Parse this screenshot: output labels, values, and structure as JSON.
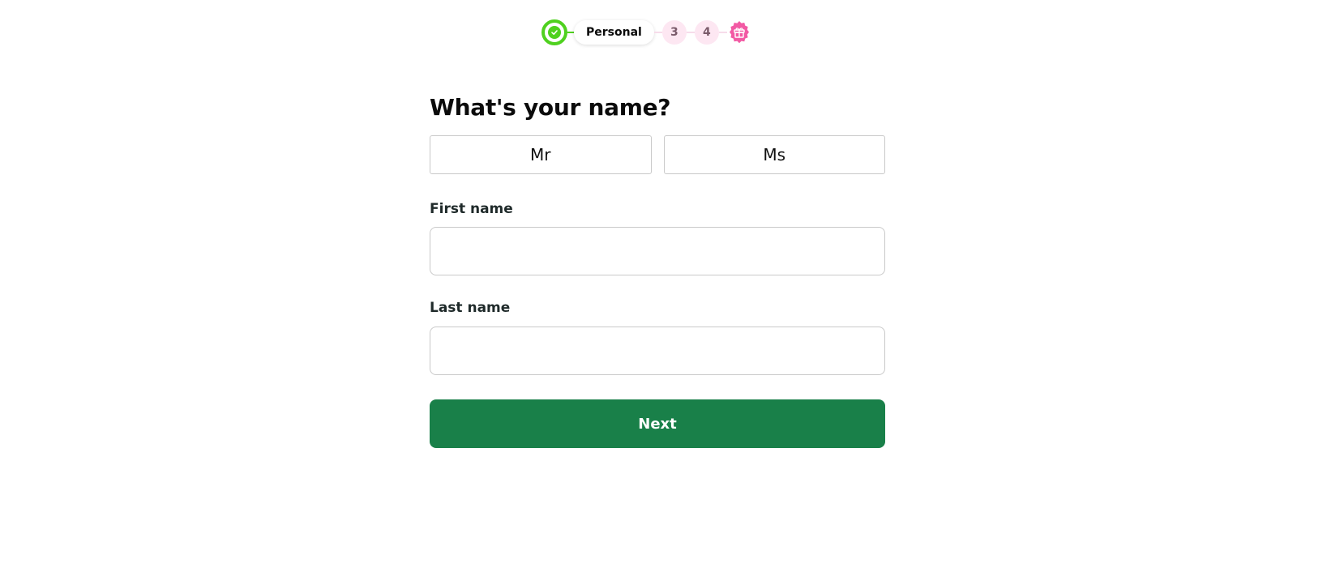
{
  "stepper": {
    "current_label": "Personal",
    "future_steps": [
      "3",
      "4"
    ],
    "accent_color": "#4fd11f",
    "future_color": "#fde7f2",
    "gift_color": "#f25aa4",
    "done_icon": "check-icon",
    "final_icon": "gift-icon"
  },
  "form": {
    "title": "What's your name?",
    "title_options": [
      "Mr",
      "Ms"
    ],
    "first_name_label": "First name",
    "first_name_value": "",
    "last_name_label": "Last name",
    "last_name_value": "",
    "next_label": "Next",
    "button_color": "#198049"
  }
}
